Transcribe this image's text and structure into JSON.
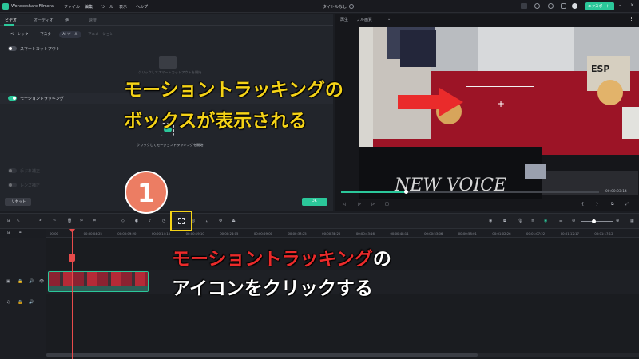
{
  "app": {
    "title": "Wondershare Filmora",
    "menu": [
      "ファイル",
      "編集",
      "ツール",
      "表示",
      "ヘルプ"
    ],
    "project_title": "タイトルなし",
    "export_label": "エクスポート"
  },
  "left_panel": {
    "tabs": [
      "ビデオ",
      "オーディオ",
      "色",
      "速度"
    ],
    "subtabs": [
      "ベーシック",
      "マスク",
      "AI ツール",
      "アニメーション"
    ],
    "smart_cutout": "スマートカットアウト",
    "smart_cutout_hint": "クリックしてスマートカットアウトを開始",
    "motion_tracking": "モーショントラッキング",
    "motion_tracking_hint": "クリックしてモーショントラッキングを開始",
    "dim_item_1": "手ぶれ補正",
    "dim_item_2": "レンズ補正",
    "reset_label": "リセット",
    "ok_label": "OK"
  },
  "preview": {
    "label": "再生",
    "quality": "フル画質",
    "time": "00:00:03:14"
  },
  "ruler": {
    "ticks": [
      "00:00",
      "00:00:04:25",
      "00:00:09:20",
      "00:00:14:15",
      "00:00:19:10",
      "00:00:24:05",
      "00:00:29:00",
      "00:00:33:25",
      "00:00:38:20",
      "00:00:43:16",
      "00:00:48:11",
      "00:00:53:06",
      "00:00:58:01",
      "00:01:02:26",
      "00:01:07:22",
      "00:01:12:17",
      "00:01:17:12"
    ]
  },
  "annotations": {
    "step_number": "1",
    "box_caption_line1": "モーショントラッキングの",
    "box_caption_line2": "ボックスが表示される",
    "icon_caption_red": "モーショントラッキング",
    "icon_caption_rest": "の",
    "icon_caption_line2": "アイコンをクリックする"
  },
  "colors": {
    "accent_green": "#2bc79a",
    "annotation_yellow": "#f5d317",
    "annotation_red": "#ea2b2b",
    "step_circle": "#ec7d63"
  }
}
